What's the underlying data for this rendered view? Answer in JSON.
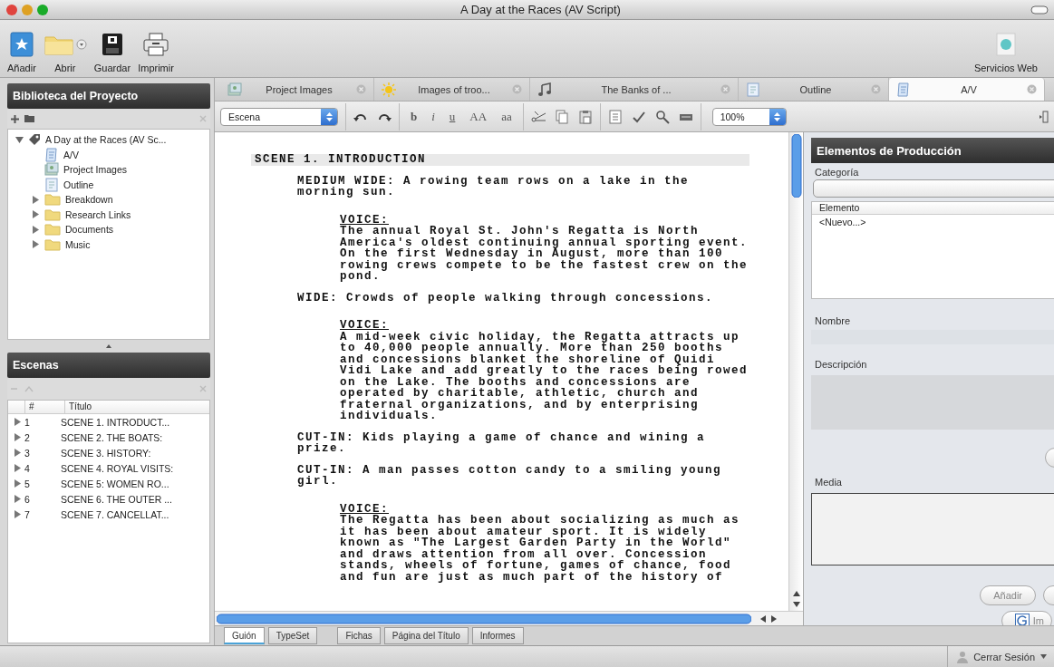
{
  "window": {
    "title": "A Day at the Races (AV Script)"
  },
  "toolbar": {
    "items": [
      {
        "label": "Añadir",
        "kind": "add"
      },
      {
        "label": "Abrir",
        "kind": "open"
      },
      {
        "label": "Guardar",
        "kind": "save"
      },
      {
        "label": "Imprimir",
        "kind": "print"
      }
    ],
    "right_item": {
      "label": "Servicios Web",
      "kind": "web"
    }
  },
  "library": {
    "title": "Biblioteca del Proyecto",
    "tree": [
      {
        "label": "A Day at the Races (AV Sc...",
        "kind": "project",
        "expanded": true,
        "children": [
          {
            "label": "A/V",
            "kind": "script"
          },
          {
            "label": "Project Images",
            "kind": "images"
          },
          {
            "label": "Outline",
            "kind": "document"
          },
          {
            "label": "Breakdown",
            "kind": "folder",
            "expanded": false
          },
          {
            "label": "Research Links",
            "kind": "folder",
            "expanded": false
          },
          {
            "label": "Documents",
            "kind": "folder",
            "expanded": false
          },
          {
            "label": "Music",
            "kind": "folder",
            "expanded": false
          }
        ]
      }
    ]
  },
  "scenes": {
    "title": "Escenas",
    "columns": [
      "#",
      "Título"
    ],
    "rows": [
      {
        "number": "1",
        "title": "SCENE 1. INTRODUCT...",
        "expanded": false
      },
      {
        "number": "2",
        "title": "SCENE 2. THE BOATS:",
        "expanded": false
      },
      {
        "number": "3",
        "title": "SCENE 3. HISTORY:",
        "expanded": false
      },
      {
        "number": "4",
        "title": "SCENE 4. ROYAL VISITS:",
        "expanded": false
      },
      {
        "number": "5",
        "title": "SCENE 5: WOMEN RO...",
        "expanded": false
      },
      {
        "number": "6",
        "title": "SCENE 6. THE OUTER ...",
        "expanded": false
      },
      {
        "number": "7",
        "title": "SCENE 7. CANCELLAT...",
        "expanded": false
      }
    ]
  },
  "doc_tabs": [
    {
      "label": "Project Images",
      "kind": "images",
      "selected": false
    },
    {
      "label": "Images of troo...",
      "kind": "sun",
      "selected": false
    },
    {
      "label": "The Banks of ...",
      "kind": "music",
      "selected": false
    },
    {
      "label": "Outline",
      "kind": "document",
      "selected": false
    },
    {
      "label": "A/V",
      "kind": "script",
      "selected": true
    }
  ],
  "format_bar": {
    "style": "Escena",
    "text_buttons": [
      {
        "label": "b",
        "kind": "bold"
      },
      {
        "label": "i",
        "kind": "italic"
      },
      {
        "label": "u",
        "kind": "underline"
      },
      {
        "label": "AA",
        "kind": "upper"
      },
      {
        "label": "aa",
        "kind": "lower"
      }
    ],
    "zoom": "100%"
  },
  "script": [
    {
      "kind": "scene",
      "lines": [
        "SCENE 1. INTRODUCTION"
      ]
    },
    {
      "kind": "shot",
      "lines": [
        "MEDIUM WIDE: A rowing team rows on a lake in the",
        "morning sun."
      ]
    },
    {
      "kind": "character",
      "lines": [
        "VOICE:"
      ]
    },
    {
      "kind": "dialogue",
      "lines": [
        "The annual Royal St. John's Regatta is North",
        "America's oldest continuing annual sporting event.",
        "On the first Wednesday in August, more than 100",
        "rowing crews compete to be the fastest crew on the",
        "pond."
      ]
    },
    {
      "kind": "shot",
      "lines": [
        "WIDE: Crowds of people walking through concessions."
      ]
    },
    {
      "kind": "character",
      "lines": [
        "VOICE:"
      ]
    },
    {
      "kind": "dialogue",
      "lines": [
        "A mid-week civic holiday, the Regatta attracts up",
        "to 40,000 people annually. More than 250 booths",
        "and concessions blanket the shoreline of Quidi",
        "Vidi Lake and add greatly to the races being rowed",
        "on the Lake. The booths and concessions are",
        "operated by charitable, athletic, church and",
        "fraternal organizations, and by enterprising",
        "individuals."
      ]
    },
    {
      "kind": "shot",
      "lines": [
        "CUT-IN: Kids playing a game of chance and wining a",
        "prize."
      ]
    },
    {
      "kind": "shot",
      "lines": [
        "CUT-IN: A man passes cotton candy to a smiling young",
        "girl."
      ]
    },
    {
      "kind": "character",
      "lines": [
        "VOICE:"
      ]
    },
    {
      "kind": "dialogue",
      "lines": [
        "The Regatta has been about socializing as much as",
        "it has been about amateur sport. It is widely",
        "known as \"The Largest Garden Party in the World\"",
        "and draws attention from all over. Concession",
        "stands, wheels of fortune, games of chance, food",
        "and fun are just as much part of the history of"
      ]
    }
  ],
  "elements": {
    "title": "Elementos de Producción",
    "category_label": "Categoría",
    "list_header": "Elemento",
    "items": [
      "<Nuevo...>"
    ],
    "name_label": "Nombre",
    "description_label": "Descripción",
    "media_label": "Media",
    "add_button": "Añadir",
    "image_button": "Im"
  },
  "bottom_tabs": [
    {
      "label": "Guión",
      "selected": true
    },
    {
      "label": "TypeSet",
      "selected": false
    },
    {
      "label": "Fichas",
      "selected": false
    },
    {
      "label": "Página del Título",
      "selected": false
    },
    {
      "label": "Informes",
      "selected": false
    }
  ],
  "status_bar": {
    "logout": "Cerrar Sesión"
  }
}
